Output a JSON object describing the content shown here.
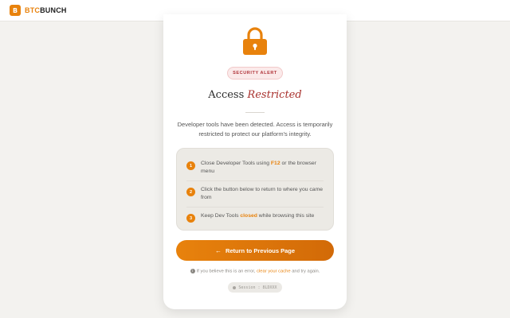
{
  "header": {
    "logo_mark": "B",
    "brand_prefix": "BTC",
    "brand_suffix": "BUNCH"
  },
  "card": {
    "badge": "SECURITY ALERT",
    "title_plain": "Access",
    "title_emphasis": "Restricted",
    "description": "Developer tools have been detected. Access is temporarily restricted to protect our platform's integrity.",
    "steps": [
      {
        "num": "1",
        "pre": "Close Developer Tools using ",
        "highlight": "F12",
        "post": " or the browser menu"
      },
      {
        "num": "2",
        "pre": "Click the button below to return to where you came from",
        "highlight": "",
        "post": ""
      },
      {
        "num": "3",
        "pre": "Keep Dev Tools ",
        "highlight": "closed",
        "post": " while browsing this site"
      }
    ],
    "button_label": "Return to Previous Page",
    "note_pre": "If you believe this is an error, ",
    "note_link": "clear your cache",
    "note_post": " and try again.",
    "session_label": "Session : 8LDXXX"
  },
  "colors": {
    "accent": "#e8820c",
    "alert": "#a8302c"
  },
  "icons": {
    "lock": "lock-icon",
    "back_arrow": "arrow-left-icon",
    "info": "info-icon"
  }
}
